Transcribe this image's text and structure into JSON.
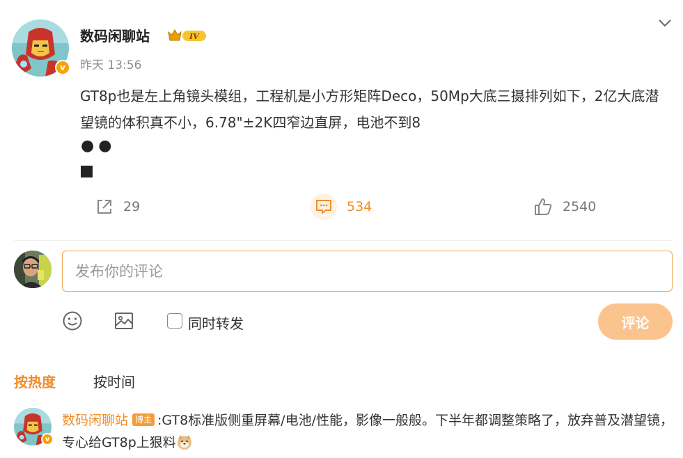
{
  "post": {
    "author": "数码闲聊站",
    "level_badge": "IV",
    "time": "昨天 13:56",
    "text": "GT8p也是左上角镜头模组，工程机是小方形矩阵Deco，50Mp大底三摄排列如下，2亿大底潜望镜的体积真不小，6.78\"±2K四窄边直屏，电池不到8",
    "dots": "●●",
    "actions": {
      "share_count": "29",
      "comment_count": "534",
      "like_count": "2540"
    }
  },
  "composer": {
    "placeholder": "发布你的评论",
    "repost_label": "同时转发",
    "submit_label": "评论"
  },
  "sort_tabs": {
    "hot": "按热度",
    "time": "按时间"
  },
  "comments": [
    {
      "author": "数码闲聊站",
      "tag": "博主",
      "text": ":GT8标准版侧重屏幕/电池/性能，影像一般般。下半年都调整策略了，放弃普及潜望镜，专心给GT8p上狠料"
    }
  ],
  "colors": {
    "accent": "#f08c28",
    "submit_disabled": "#fbc48f",
    "input_border": "#f3a44e",
    "verified": "#f7a200"
  },
  "icons": [
    "ironman-avatar",
    "verified-icon",
    "crown-level-icon",
    "chevron-down-icon",
    "share-icon",
    "comment-icon",
    "like-icon",
    "emoji-icon",
    "image-icon",
    "doge-emoji-icon"
  ]
}
